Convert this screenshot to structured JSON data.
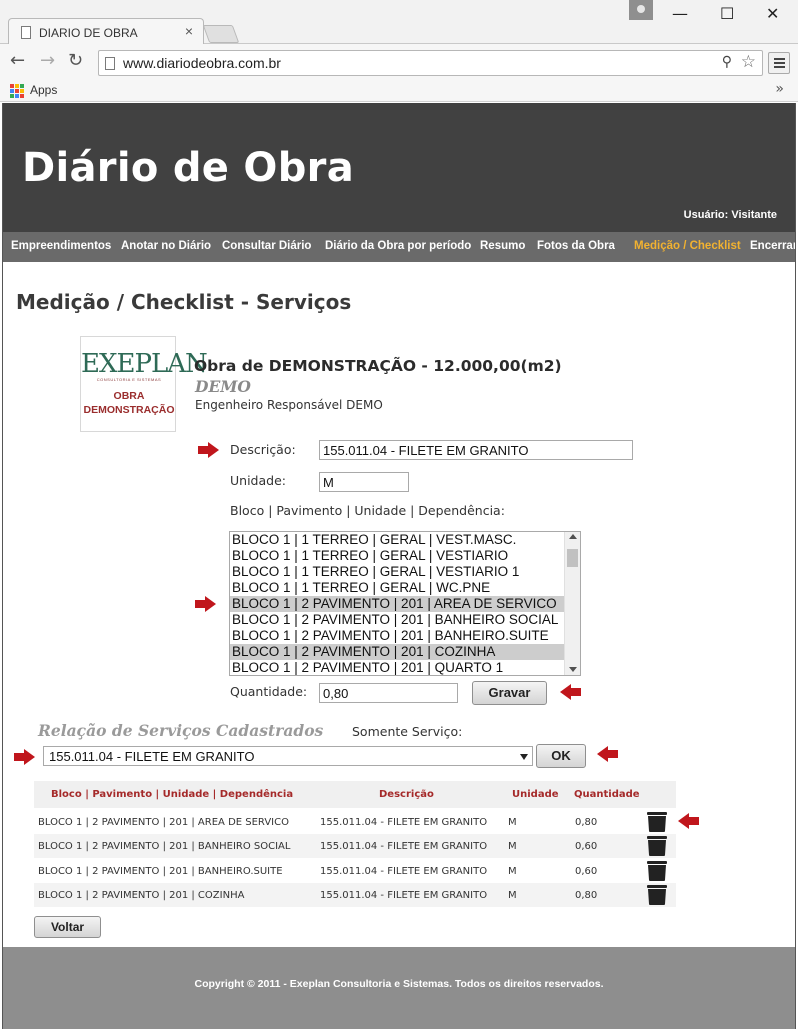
{
  "browser": {
    "tab_title": "DIARIO DE OBRA",
    "tab_close": "×",
    "url": "www.diariodeobra.com.br",
    "bookmarks_apps": "Apps",
    "bookmarks_more": "»",
    "window_controls": [
      "—",
      "☐",
      "✕"
    ]
  },
  "header": {
    "site_title": "Diário de Obra",
    "user_label": "Usuário: Visitante"
  },
  "nav": {
    "items": [
      {
        "label": "Empreendimentos"
      },
      {
        "label": "Anotar no Diário"
      },
      {
        "label": "Consultar Diário"
      },
      {
        "label": "Diário da Obra por período"
      },
      {
        "label": "Resumo"
      },
      {
        "label": "Fotos da Obra"
      },
      {
        "label": "Medição / Checklist"
      },
      {
        "label": "Encerrar"
      }
    ],
    "active_color": "#f2b230"
  },
  "page": {
    "title": "Medição / Checklist - Serviços"
  },
  "logo": {
    "brand": "EXEPLAN",
    "tagline": "CONSULTORIA E SISTEMAS",
    "line1": "OBRA",
    "line2": "DEMONSTRAÇÃO"
  },
  "obra": {
    "title": "Obra de DEMONSTRAÇÃO - 12.000,00(m2)",
    "subtitle": "DEMO",
    "engineer": "Engenheiro Responsável DEMO"
  },
  "form": {
    "descricao_label": "Descrição:",
    "descricao_value": "155.011.04 - FILETE EM GRANITO",
    "unidade_label": "Unidade:",
    "unidade_value": "M",
    "bloco_label": "Bloco | Pavimento | Unidade | Dependência:",
    "listbox_options": [
      {
        "label": "BLOCO 1 | 1 TERREO | GERAL | VEST.MASC.",
        "selected": false
      },
      {
        "label": "BLOCO 1 | 1 TERREO | GERAL | VESTIARIO",
        "selected": false
      },
      {
        "label": "BLOCO 1 | 1 TERREO | GERAL | VESTIARIO 1",
        "selected": false
      },
      {
        "label": "BLOCO 1 | 1 TERREO | GERAL | WC.PNE",
        "selected": false
      },
      {
        "label": "BLOCO 1 | 2 PAVIMENTO | 201 | AREA DE SERVICO",
        "selected": true
      },
      {
        "label": "BLOCO 1 | 2 PAVIMENTO | 201 | BANHEIRO SOCIAL",
        "selected": false
      },
      {
        "label": "BLOCO 1 | 2 PAVIMENTO | 201 | BANHEIRO.SUITE",
        "selected": false
      },
      {
        "label": "BLOCO 1 | 2 PAVIMENTO | 201 | COZINHA",
        "selected": true
      },
      {
        "label": "BLOCO 1 | 2 PAVIMENTO | 201 | QUARTO 1",
        "selected": false
      }
    ],
    "quantidade_label": "Quantidade:",
    "quantidade_value": "0,80",
    "gravar_label": "Gravar"
  },
  "relacao": {
    "title": "Relação de Serviços Cadastrados",
    "somente_label": "Somente Serviço:",
    "select_value": "155.011.04 - FILETE EM GRANITO",
    "ok_label": "OK"
  },
  "table": {
    "headers": [
      "Bloco | Pavimento | Unidade | Dependência",
      "Descrição",
      "Unidade",
      "Quantidade"
    ],
    "rows": [
      {
        "bloco": "BLOCO 1 | 2 PAVIMENTO | 201 | AREA DE SERVICO",
        "descricao": "155.011.04 - FILETE EM GRANITO",
        "unidade": "M",
        "quantidade": "0,80"
      },
      {
        "bloco": "BLOCO 1 | 2 PAVIMENTO | 201 | BANHEIRO SOCIAL",
        "descricao": "155.011.04 - FILETE EM GRANITO",
        "unidade": "M",
        "quantidade": "0,60"
      },
      {
        "bloco": "BLOCO 1 | 2 PAVIMENTO | 201 | BANHEIRO.SUITE",
        "descricao": "155.011.04 - FILETE EM GRANITO",
        "unidade": "M",
        "quantidade": "0,60"
      },
      {
        "bloco": "BLOCO 1 | 2 PAVIMENTO | 201 | COZINHA",
        "descricao": "155.011.04 - FILETE EM GRANITO",
        "unidade": "M",
        "quantidade": "0,80"
      }
    ]
  },
  "actions": {
    "voltar_label": "Voltar"
  },
  "footer": {
    "text": "Copyright © 2011 - Exeplan Consultoria e Sistemas. Todos os direitos reservados."
  },
  "colors": {
    "header_bg": "#414141",
    "nav_bg": "#6a6a6a",
    "footer_bg": "#8e8e8e",
    "table_header_text": "#a52a2a",
    "annotation_arrow": "#c0161c"
  },
  "icons": {
    "trash": "trash-icon",
    "arrow": "red-arrow-icon"
  }
}
